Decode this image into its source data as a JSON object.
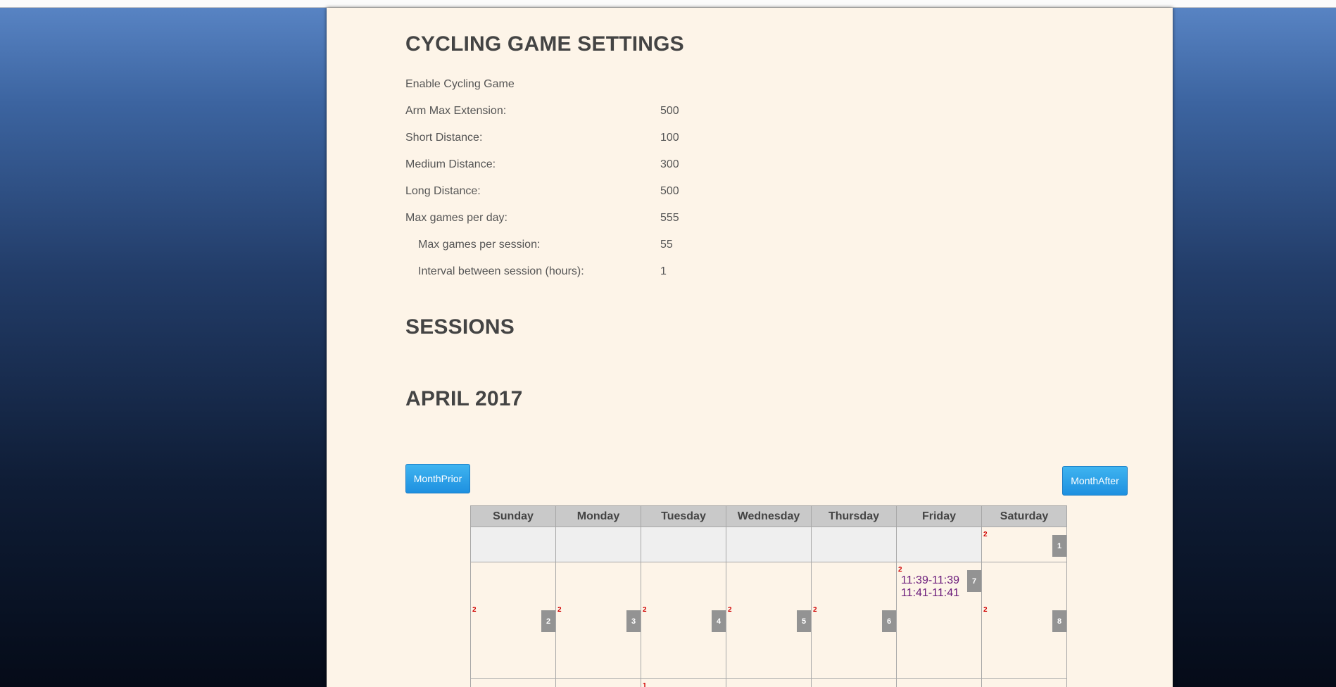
{
  "settings": {
    "heading": "CYCLING GAME SETTINGS",
    "enable_label": "Enable Cycling Game",
    "rows": [
      {
        "label": "Arm Max Extension:",
        "value": "500"
      },
      {
        "label": "Short Distance:",
        "value": "100"
      },
      {
        "label": "Medium Distance:",
        "value": "300"
      },
      {
        "label": "Long Distance:",
        "value": "500"
      },
      {
        "label": "Max games per day:",
        "value": "555"
      },
      {
        "label": "Max games per session:",
        "value": "55"
      },
      {
        "label": "Interval between session (hours):",
        "value": "1"
      }
    ]
  },
  "sessions": {
    "heading": "SESSIONS",
    "month_title": "APRIL 2017",
    "prev_button": "MonthPrior",
    "next_button": "MonthAfter"
  },
  "calendar": {
    "weekdays": [
      "Sunday",
      "Monday",
      "Tuesday",
      "Wednesday",
      "Thursday",
      "Friday",
      "Saturday"
    ],
    "week1": [
      {
        "day": "",
        "count": ""
      },
      {
        "day": "",
        "count": ""
      },
      {
        "day": "",
        "count": ""
      },
      {
        "day": "",
        "count": ""
      },
      {
        "day": "",
        "count": ""
      },
      {
        "day": "",
        "count": ""
      },
      {
        "day": "1",
        "count": "2"
      }
    ],
    "week2": [
      {
        "day": "2",
        "count": "2"
      },
      {
        "day": "3",
        "count": "2"
      },
      {
        "day": "4",
        "count": "2"
      },
      {
        "day": "5",
        "count": "2"
      },
      {
        "day": "6",
        "count": "2"
      },
      {
        "day": "7",
        "count": "2",
        "sessions": [
          "11:39-11:39",
          "11:41-11:41"
        ]
      },
      {
        "day": "8",
        "count": "2"
      }
    ],
    "week3": [
      {
        "day": "",
        "count": ""
      },
      {
        "day": "",
        "count": ""
      },
      {
        "day": "",
        "count": "1"
      },
      {
        "day": "",
        "count": ""
      },
      {
        "day": "",
        "count": ""
      },
      {
        "day": "",
        "count": ""
      },
      {
        "day": "",
        "count": ""
      }
    ]
  },
  "colors": {
    "accent_button": "#1e90e0",
    "count_red": "#d00000",
    "session_purple": "#6a1a7a",
    "panel_bg": "#fdf4e8"
  }
}
